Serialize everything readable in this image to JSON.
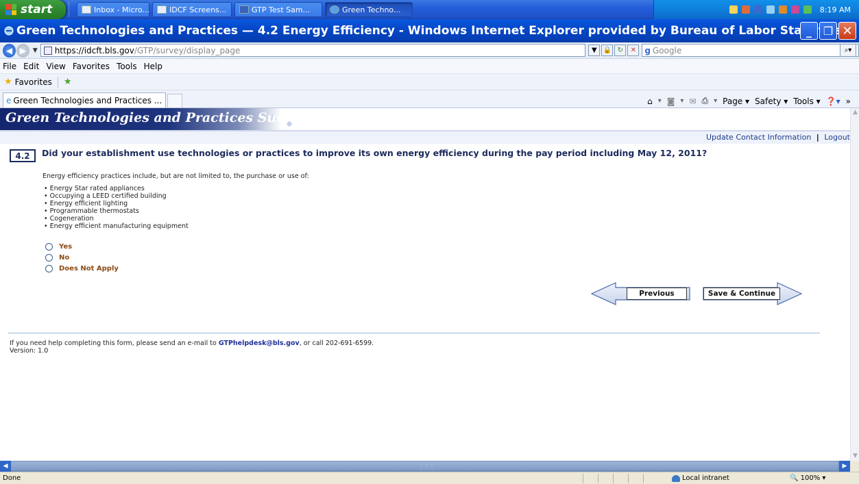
{
  "taskbar": {
    "start_label": "start",
    "tasks": [
      {
        "label": "Inbox - Micro..."
      },
      {
        "label": "IDCF Screens..."
      },
      {
        "label": "GTP Test Sam..."
      },
      {
        "label": "Green Techno..."
      }
    ],
    "clock": "8:19 AM"
  },
  "window": {
    "title": "Green Technologies and Practices — 4.2 Energy Efficiency - Windows Internet Explorer provided by Bureau of Labor Statistics"
  },
  "addressbar": {
    "url_base": "https://idcft.bls.gov",
    "url_path": "/GTP/survey/display_page",
    "search_placeholder": "Google"
  },
  "menubar": {
    "items": [
      "File",
      "Edit",
      "View",
      "Favorites",
      "Tools",
      "Help"
    ]
  },
  "favorites": {
    "label": "Favorites"
  },
  "tabs": {
    "active_label": "Green Technologies and Practices ..."
  },
  "commandbar": {
    "page": "Page",
    "safety": "Safety",
    "tools": "Tools"
  },
  "page": {
    "banner_title": "Green Technologies and Practices Survey",
    "util_update": "Update Contact Information",
    "util_sep": "|",
    "util_logout": "Logout",
    "question_number": "4.2",
    "question_text": "Did your establishment use technologies or practices to improve its own energy efficiency during the pay period including May 12, 2011?",
    "intro": "Energy efficiency practices include, but are not limited to, the purchase or use of:",
    "bullets": [
      "Energy Star rated appliances",
      "Occupying a LEED certified building",
      "Energy efficient lighting",
      "Programmable thermostats",
      "Cogeneration",
      "Energy efficient manufacturing equipment"
    ],
    "options": [
      "Yes",
      "No",
      "Does Not Apply"
    ],
    "previous_label": "Previous",
    "next_label": "Save & Continue",
    "help_prefix": "If you need help completing this form, please send an e-mail to ",
    "help_email": "GTPhelpdesk@bls.gov",
    "help_suffix": ", or call 202-691-6599.",
    "version": "Version: 1.0"
  },
  "statusbar": {
    "status": "Done",
    "zone": "Local intranet",
    "zoom": "100%"
  }
}
